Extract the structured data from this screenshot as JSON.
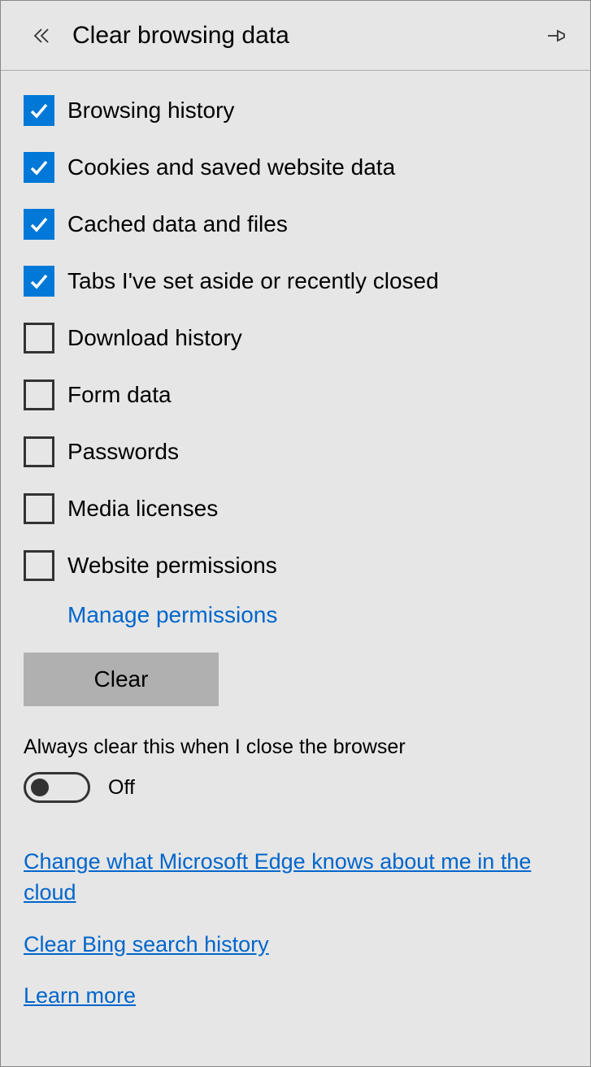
{
  "header": {
    "title": "Clear browsing data"
  },
  "options": [
    {
      "label": "Browsing history",
      "checked": true
    },
    {
      "label": "Cookies and saved website data",
      "checked": true
    },
    {
      "label": "Cached data and files",
      "checked": true
    },
    {
      "label": "Tabs I've set aside or recently closed",
      "checked": true
    },
    {
      "label": "Download history",
      "checked": false
    },
    {
      "label": "Form data",
      "checked": false
    },
    {
      "label": "Passwords",
      "checked": false
    },
    {
      "label": "Media licenses",
      "checked": false
    },
    {
      "label": "Website permissions",
      "checked": false
    }
  ],
  "managePermissions": "Manage permissions",
  "clearButton": "Clear",
  "autoClear": {
    "label": "Always clear this when I close the browser",
    "state": "Off",
    "enabled": false
  },
  "links": [
    "Change what Microsoft Edge knows about me in the cloud",
    "Clear Bing search history",
    "Learn more"
  ]
}
